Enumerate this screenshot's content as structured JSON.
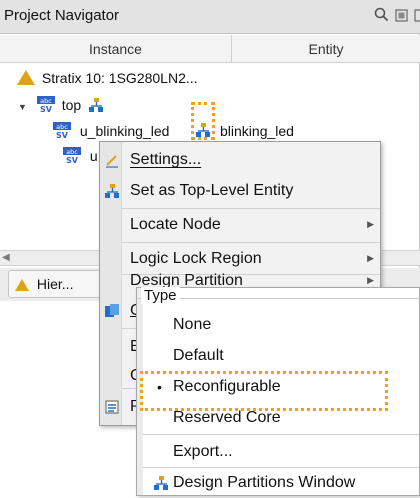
{
  "navigator": {
    "title": "Project Navigator",
    "columns": {
      "instance": "Instance",
      "entity": "Entity"
    },
    "rows": {
      "device": "Stratix 10: 1SG280LN2...",
      "top": "top",
      "instance1": "u_blinking_led",
      "entity1": "blinking_led",
      "instance2_partial": "u"
    },
    "tab_label": "Hier...",
    "icon_names": [
      "search-icon",
      "restore-icon",
      "close-icon"
    ]
  },
  "context_menu": {
    "items": {
      "settings": "Settings...",
      "set_top_level": "Set as Top-Level Entity",
      "locate_node": "Locate Node",
      "logic_lock_region": "Logic Lock Region",
      "design_partition": "Design Partition",
      "c_partial": "C",
      "e_partial": "E",
      "c2_partial": "C",
      "p_partial": "P"
    }
  },
  "submenu": {
    "type_legend": "Type",
    "items": {
      "none": "None",
      "default": "Default",
      "reconfigurable": "Reconfigurable",
      "reserved_core": "Reserved Core",
      "export": "Export...",
      "window": "Design Partitions Window"
    },
    "selected": "Reconfigurable",
    "bullet": "•"
  },
  "colors": {
    "highlight_dotted": "#f0a020",
    "device_triangle": "#e0a21a",
    "hierarchy_icon": "#1f6fc8"
  }
}
